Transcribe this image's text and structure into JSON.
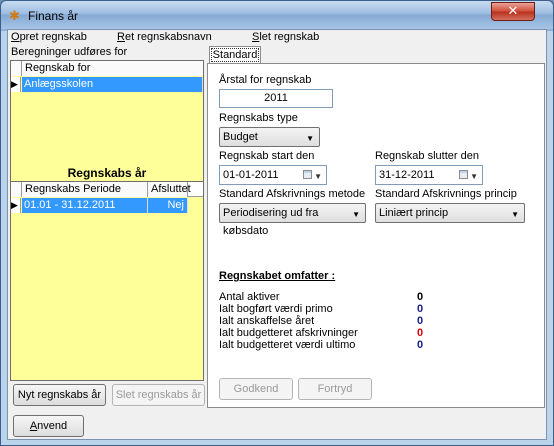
{
  "window": {
    "title": "Finans år",
    "close_label": "✕"
  },
  "menu": [
    {
      "label": "Opret regnskab"
    },
    {
      "label": "Ret regnskabsnavn"
    },
    {
      "label": "Slet regnskab"
    }
  ],
  "left_panel": {
    "caption": "Beregninger udføres for",
    "accounts_grid": {
      "column": "Regnskab for",
      "rows": [
        {
          "name": "Anlægsskolen"
        }
      ]
    },
    "years_title": "Regnskabs år",
    "years_grid": {
      "columns": [
        "Regnskabs Periode",
        "Afsluttet"
      ],
      "rows": [
        {
          "period": "01.01 - 31.12.2011",
          "closed": "Nej"
        }
      ]
    },
    "new_year_button": "Nyt regnskabs år",
    "delete_year_button": "Slet regnskabs år"
  },
  "tab": {
    "label": "Standard"
  },
  "form": {
    "year_label": "Årstal for regnskab",
    "year_value": "2011",
    "type_label": "Regnskabs type",
    "type_value": "Budget",
    "start_label": "Regnskab start den",
    "start_value": "01-01-2011",
    "end_label": "Regnskab slutter den",
    "end_value": "31-12-2011",
    "method_label": "Standard Afskrivnings metode",
    "method_value": "Periodisering ud fra købsdato",
    "principle_label": "Standard Afskrivnings princip",
    "principle_value": "Liniært princip"
  },
  "summary": {
    "title": "Regnskabet omfatter :",
    "items": [
      {
        "label": "Antal aktiver",
        "value": "0",
        "color": "#000000"
      },
      {
        "label": "Ialt bogført værdi primo",
        "value": "0",
        "color": "#1a1a8c"
      },
      {
        "label": "Ialt anskaffelse året",
        "value": "0",
        "color": "#1a1a8c"
      },
      {
        "label": "Ialt budgetteret afskrivninger",
        "value": "0",
        "color": "#e00000"
      },
      {
        "label": "Ialt budgetteret værdi ultimo",
        "value": "0",
        "color": "#1a1a8c"
      }
    ]
  },
  "actions": {
    "approve": "Godkend",
    "undo": "Fortryd",
    "apply": "Anvend"
  }
}
